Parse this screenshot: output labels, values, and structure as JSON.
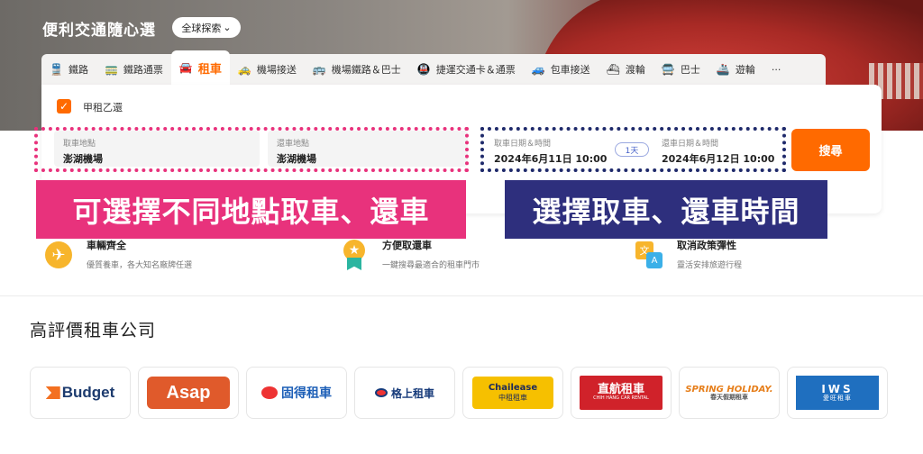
{
  "hero": {
    "title": "便利交通隨心選",
    "explore_label": "全球探索"
  },
  "tabs": [
    {
      "label": "鐵路",
      "icon": "train-icon"
    },
    {
      "label": "鐵路通票",
      "icon": "rail-pass-icon"
    },
    {
      "label": "租車",
      "icon": "car-rental-icon",
      "active": true
    },
    {
      "label": "機場接送",
      "icon": "airport-transfer-icon"
    },
    {
      "label": "機場鐵路＆巴士",
      "icon": "airport-rail-bus-icon"
    },
    {
      "label": "捷運交通卡＆通票",
      "icon": "metro-card-icon"
    },
    {
      "label": "包車接送",
      "icon": "charter-car-icon"
    },
    {
      "label": "渡輪",
      "icon": "ferry-icon"
    },
    {
      "label": "巴士",
      "icon": "bus-icon"
    },
    {
      "label": "遊輪",
      "icon": "cruise-icon"
    },
    {
      "label": "···",
      "icon": "more-icon"
    }
  ],
  "search": {
    "different_return_label": "甲租乙還",
    "pickup_label": "取車地點",
    "pickup_value": "澎湖機場",
    "dropoff_label": "還車地點",
    "dropoff_value": "澎湖機場",
    "pickup_time_label": "取車日期＆時間",
    "pickup_time_value": "2024年6月11日 10:00",
    "duration": "1天",
    "dropoff_time_label": "還車日期＆時間",
    "dropoff_time_value": "2024年6月12日 10:00",
    "search_button": "搜尋"
  },
  "annotations": {
    "location": "可選擇不同地點取車、還車",
    "time": "選擇取車、還車時間"
  },
  "features": [
    {
      "title": "車輛齊全",
      "desc": "優質養車，各大知名廠牌任選",
      "icon": "plane-icon"
    },
    {
      "title": "方便取還車",
      "desc": "一鍵搜尋最適合的租車門市",
      "icon": "medal-icon"
    },
    {
      "title": "取消政策彈性",
      "desc": "靈活安排旅遊行程",
      "icon": "translate-icon"
    }
  ],
  "section_title": "高評價租車公司",
  "brands": [
    {
      "name": "Budget"
    },
    {
      "name": "Asap"
    },
    {
      "name": "固得租車"
    },
    {
      "name": "格上租車"
    },
    {
      "name": "Chailease",
      "sub": "中租租車"
    },
    {
      "name": "直航租車",
      "sub": "CHIH HANG CAR RENTAL"
    },
    {
      "name": "SPRING HOLIDAY.",
      "sub": "春天假期租車"
    },
    {
      "name": "IWS",
      "sub": "愛旺租車"
    }
  ],
  "colors": {
    "accent": "#ff6a00",
    "annotation_pink": "#e8327c",
    "annotation_navy": "#2e2f7d"
  }
}
